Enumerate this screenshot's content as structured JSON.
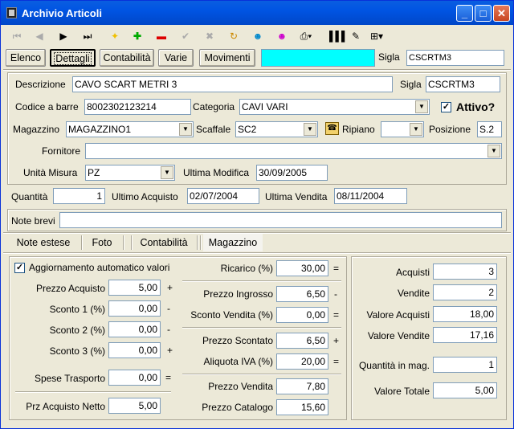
{
  "window": {
    "title": "Archivio Articoli",
    "minimize": "_",
    "maximize": "□",
    "close": "✕"
  },
  "toolbar": {
    "icons": [
      "first-icon",
      "prev-icon",
      "next-icon",
      "last-icon",
      "add-icon",
      "plus-icon",
      "minus-icon",
      "confirm-icon",
      "cancel-icon",
      "refresh-icon",
      "user-icon",
      "user2-icon",
      "print-icon",
      "barcode-icon",
      "edit-icon",
      "tree-icon"
    ]
  },
  "tabs": {
    "elenco": "Elenco",
    "dettagli": "Dettagli",
    "contabilita": "Contabilità",
    "varie": "Varie",
    "movimenti": "Movimenti"
  },
  "top_sigla": {
    "label": "Sigla",
    "value": "CSCRTM3"
  },
  "form": {
    "descrizione_label": "Descrizione",
    "descrizione": "CAVO SCART METRI 3",
    "sigla_label": "Sigla",
    "sigla": "CSCRTM3",
    "codice_label": "Codice a barre",
    "codice": "8002302123214",
    "categoria_label": "Categoria",
    "categoria": "CAVI VARI",
    "attivo_label": "Attivo?",
    "attivo_check": "✓",
    "magazzino_label": "Magazzino",
    "magazzino": "MAGAZZINO1",
    "scaffale_label": "Scaffale",
    "scaffale": "SC2",
    "ripiano_label": "Ripiano",
    "ripiano": "",
    "posizione_label": "Posizione",
    "posizione": "S.2",
    "fornitore_label": "Fornitore",
    "fornitore": "",
    "unita_label": "Unità Misura",
    "unita": "PZ",
    "ultima_mod_label": "Ultima Modifica",
    "ultima_mod": "30/09/2005",
    "quantita_label": "Quantità",
    "quantita": "1",
    "ultimo_acq_label": "Ultimo Acquisto",
    "ultimo_acq": "02/07/2004",
    "ultima_vend_label": "Ultima Vendita",
    "ultima_vend": "08/11/2004",
    "note_label": "Note brevi",
    "note": ""
  },
  "subtabs": {
    "note_estese": "Note estese",
    "foto": "Foto",
    "contabilita": "Contabilità",
    "magazzino": "Magazzino"
  },
  "calc": {
    "auto_label": "Aggiornamento automatico valori",
    "auto_check": "✓",
    "prezzo_acq_label": "Prezzo Acquisto",
    "prezzo_acq": "5,00",
    "sconto1_label": "Sconto 1 (%)",
    "sconto1": "0,00",
    "sconto2_label": "Sconto 2 (%)",
    "sconto2": "0,00",
    "sconto3_label": "Sconto 3 (%)",
    "sconto3": "0,00",
    "spese_label": "Spese Trasporto",
    "spese": "0,00",
    "netto_label": "Prz Acquisto Netto",
    "netto": "5,00",
    "ricarico_label": "Ricarico (%)",
    "ricarico": "30,00",
    "ingrosso_label": "Prezzo Ingrosso",
    "ingrosso": "6,50",
    "sconto_vend_label": "Sconto Vendita (%)",
    "sconto_vend": "0,00",
    "scontato_label": "Prezzo Scontato",
    "scontato": "6,50",
    "iva_label": "Aliquota IVA (%)",
    "iva": "20,00",
    "vendita_label": "Prezzo Vendita",
    "vendita": "7,80",
    "catalogo_label": "Prezzo Catalogo",
    "catalogo": "15,60",
    "ops": {
      "plus": "+",
      "minus": "-",
      "eq": "="
    }
  },
  "stats": {
    "acquisti_label": "Acquisti",
    "acquisti": "3",
    "vendite_label": "Vendite",
    "vendite": "2",
    "val_acq_label": "Valore Acquisti",
    "val_acq": "18,00",
    "val_vend_label": "Valore Vendite",
    "val_vend": "17,16",
    "qta_mag_label": "Quantità in mag.",
    "qta_mag": "1",
    "totale_label": "Valore Totale",
    "totale": "5,00"
  }
}
